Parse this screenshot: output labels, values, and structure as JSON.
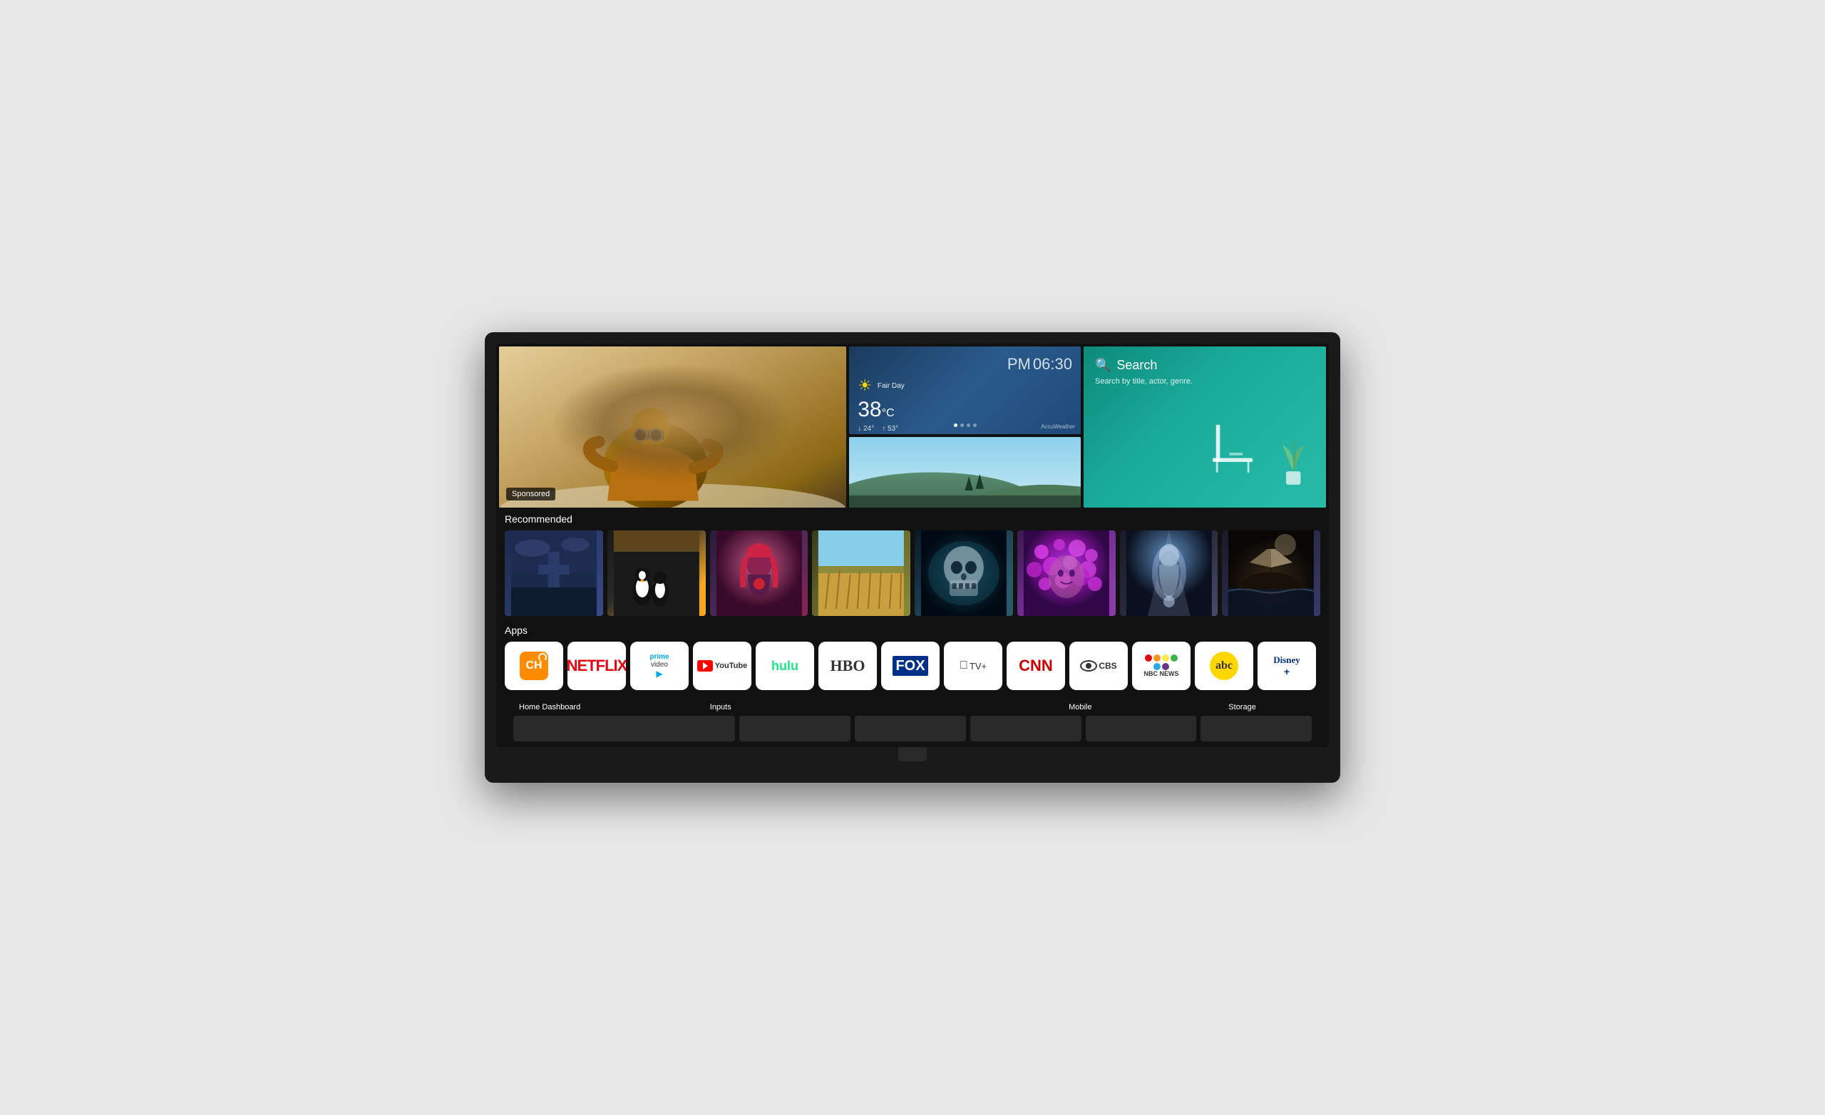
{
  "tv": {
    "hero": {
      "sponsored_label": "Sponsored",
      "time": {
        "period": "PM",
        "value": "06:30"
      },
      "weather": {
        "condition": "Fair Day",
        "temperature": "38",
        "unit": "c",
        "low": "↓ 24°",
        "high": "↑ 53°",
        "provider": "AccuWeather"
      },
      "search": {
        "title": "Search",
        "subtitle": "Search by title, actor, genre."
      }
    },
    "sections": {
      "recommended_label": "Recommended",
      "apps_label": "Apps"
    },
    "apps": [
      {
        "id": "ch",
        "name": "CH (Live TV)",
        "label": "CH"
      },
      {
        "id": "netflix",
        "name": "Netflix",
        "label": "NETFLIX"
      },
      {
        "id": "primevideo",
        "name": "Prime Video",
        "label": "prime video"
      },
      {
        "id": "youtube",
        "name": "YouTube",
        "label": "YouTube"
      },
      {
        "id": "hulu",
        "name": "Hulu",
        "label": "hulu"
      },
      {
        "id": "hbo",
        "name": "HBO",
        "label": "HBO"
      },
      {
        "id": "fox",
        "name": "FOX",
        "label": "FOX"
      },
      {
        "id": "appletv",
        "name": "Apple TV+",
        "label": "Apple TV+"
      },
      {
        "id": "cnn",
        "name": "CNN",
        "label": "CNN"
      },
      {
        "id": "cbs",
        "name": "CBS",
        "label": "CBS"
      },
      {
        "id": "nbcnews",
        "name": "NBC News",
        "label": "NBC NEWS"
      },
      {
        "id": "abc",
        "name": "ABC",
        "label": "abc"
      },
      {
        "id": "disney",
        "name": "Disney+",
        "label": "Disney+"
      }
    ],
    "bottom_nav": {
      "items": [
        {
          "label": "Home Dashboard",
          "width": "wide"
        },
        {
          "label": "Inputs",
          "width": "normal"
        },
        {
          "label": "",
          "width": "normal"
        },
        {
          "label": "",
          "width": "normal"
        },
        {
          "label": "Mobile",
          "width": "normal"
        },
        {
          "label": "Storage",
          "width": "normal"
        }
      ]
    }
  }
}
